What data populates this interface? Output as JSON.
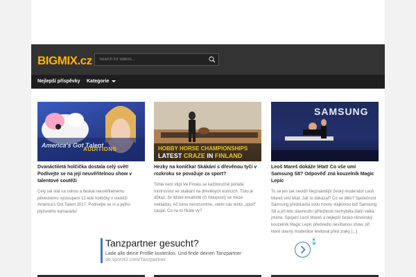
{
  "header": {
    "logo_main": "BIGMIX",
    "logo_tld": ".cz",
    "search_placeholder": "Search for videos..."
  },
  "nav": {
    "items": [
      {
        "label": "Nejlepší příspěvky"
      },
      {
        "label": "Kategorie"
      }
    ]
  },
  "cards": [
    {
      "thumb_text": "AUDITIONS",
      "thumb_brand": "America's Got Talent",
      "title": "Dvanáctiletá holčička dostala celý svět! Podívejte se na její neuvěřitelnou show v talentové soutěži",
      "excerpt": "Celý sál stál na nohou a tleskal neuvěřitelnému pěveckému vystoupení 12-leté holčičky v soutěži America's Got Talent 2017. Podívejte se ni a jejího plyšového kamaráda!"
    },
    {
      "thumb_line1": "HOBBY HORSE CHAMPIONSHIPS",
      "thumb_line2a": "LATEST ",
      "thumb_line2b": "CRAZE",
      "thumb_line2c": " IN ",
      "thumb_line2d": "FINLAND",
      "title": "Hezky na koníčka! Skákání s dřevěnou tyčí v rozkroku se považuje za sport?",
      "excerpt": "Tohle není vtip! Ve Finsku se každoročně pořádá mistrovství ve skákání na dřevěných konících. Tisto je důkaz, že lidské kreativitě (či hlouposti) se meze nekladou. Ač tomu nerozumíme, velmi nás tento „sport\" zaujal. Co na to říkáte vy?"
    },
    {
      "thumb_text": "SAMSUNG",
      "title": "Leoš Mareš dokáže létat! Co vše umí Samsung S8? Odpověď zná kouzelník Magic Lepic",
      "excerpt": "To se jen tak nevidí! Nejznámější český moderátor Leoš Mareš umí létat. Jak to dokázal? Co se dělo? Společnost Samsung představila svou novou vlajkovou loď Samsung S8 a při této slavnostní příležitosti nechyběla další velká jména. Spojení Leoš Mareš a nejlepší česko-slovenský kouzelník Magic Lepic předvedlo nevídanou show, při které slavný moderátor levitoval před zraky [...]"
    }
  ],
  "ad": {
    "headline": "Tanzpartner gesucht?",
    "subline": "Lade alle deine Profile kostenlos. Und finde deinen Tanzpartner",
    "url": "de.sport42.com/Tanzpartner"
  },
  "colors": {
    "logo": "#ffb400",
    "header_bg": "#333333",
    "nav_bg": "#1e1e1e",
    "ad_accent": "#3b78c4",
    "thumb_caption": "#f0c419"
  }
}
